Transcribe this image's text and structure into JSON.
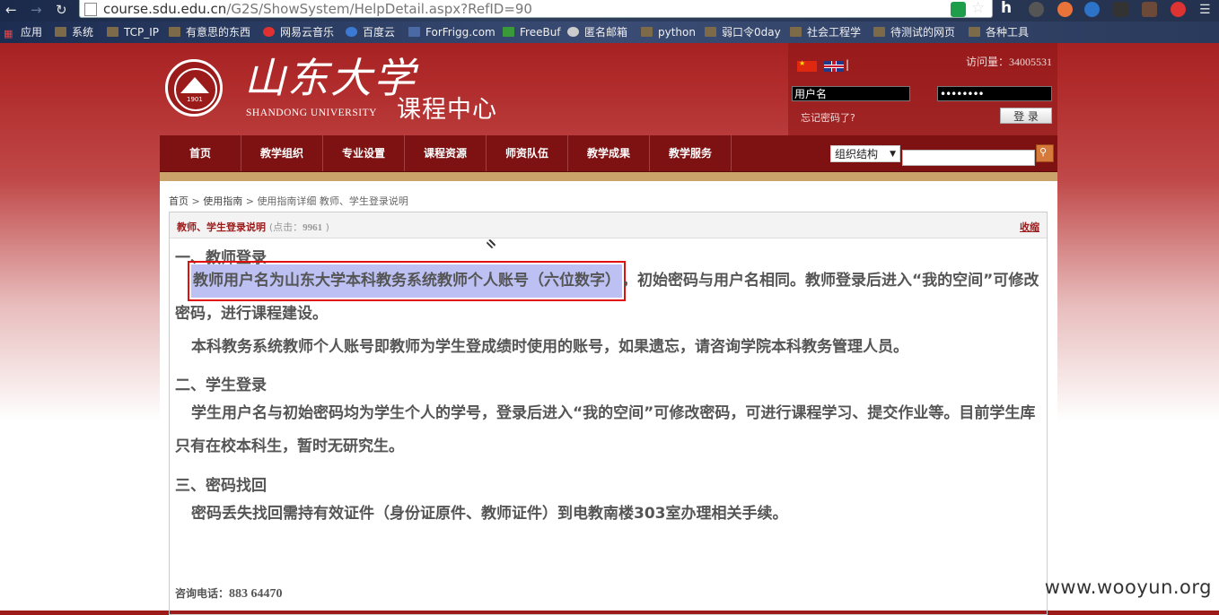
{
  "browser": {
    "url_host": "course.sdu.edu.cn",
    "url_path": "/G2S/ShowSystem/HelpDetail.aspx?RefID=90",
    "bookmarks": [
      "应用",
      "系统",
      "TCP_IP",
      "有意思的东西",
      "网易云音乐",
      "百度云",
      "ForFrigg.com",
      "FreeBuf",
      "匿名邮箱",
      "python",
      "弱口令0day",
      "社会工程学",
      "待测试的网页",
      "各种工具"
    ]
  },
  "header": {
    "logo_calligraphy": "山东大学",
    "logo_english": "SHANDONG UNIVERSITY",
    "seal_year": "1901",
    "site_title": "课程中心",
    "visit_counter": "访问量：34005531",
    "username_value": "用户名",
    "password_value": "••••••••",
    "forgot_password": "忘记密码了?",
    "login_button": "登 录"
  },
  "nav": {
    "items": [
      "首页",
      "教学组织",
      "专业设置",
      "课程资源",
      "师资队伍",
      "教学成果",
      "教学服务"
    ],
    "select_value": "组织结构"
  },
  "breadcrumb": {
    "home": "首页",
    "sep1": " > ",
    "guide": "使用指南",
    "sep2": " > ",
    "current": "使用指南详细 教师、学生登录说明"
  },
  "article": {
    "title": "教师、学生登录说明",
    "clicks_label": "(点击：",
    "clicks_value": "9961",
    "clicks_close": ")",
    "collapse": "收缩",
    "sec1_heading": "一、教师登录",
    "sec1_highlight": "教师用户名为山东大学本科教务系统教师个人账号（六位数字）",
    "sec1_p1_rest": "，初始密码与用户名相同。教师登录后进入“我的空间”可修改密码，进行课程建设。",
    "sec1_p2": "本科教务系统教师个人账号即教师为学生登成绩时使用的账号，如果遗忘，请咨询学院本科教务管理人员。",
    "sec2_heading": "二、学生登录",
    "sec2_p1": "学生用户名与初始密码均为学生个人的学号，登录后进入“我的空间”可修改密码，可进行课程学习、提交作业等。目前学生库只有在校本科生，暂时无研究生。",
    "sec3_heading": "三、密码找回",
    "sec3_p1": "密码丢失找回需持有效证件（身份证原件、教师证件）到电教南楼303室办理相关手续。",
    "phone_label": "咨询电话：",
    "phone_value": "883 64470"
  },
  "watermark": "www.wooyun.org"
}
